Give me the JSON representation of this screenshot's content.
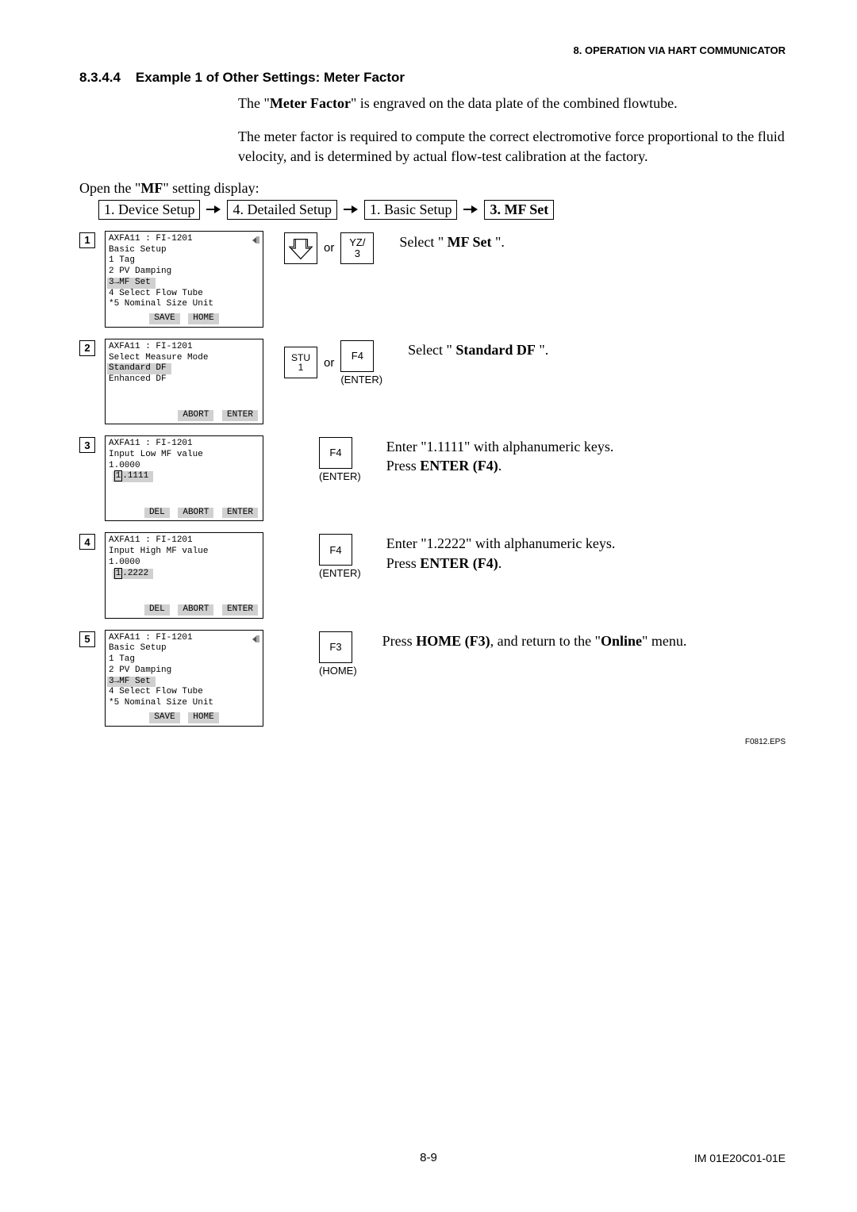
{
  "header": {
    "chapter": "8.  OPERATION VIA HART COMMUNICATOR"
  },
  "section": {
    "number": "8.3.4.4",
    "title": "Example 1 of Other Settings: Meter Factor"
  },
  "paras": {
    "p1a": "The \"",
    "p1b": "Meter Factor",
    "p1c": "\" is engraved on the data plate of the combined flowtube.",
    "p2": "The meter factor is required to compute the correct electromotive force proportional to the fluid velocity, and is determined by actual flow-test calibration at the factory."
  },
  "open": {
    "a": "Open the \"",
    "b": "MF",
    "c": "\" setting display:"
  },
  "breadcrumb": {
    "b1": "1. Device Setup",
    "b2": "4. Detailed Setup",
    "b3": "1. Basic Setup",
    "b4": "3. MF Set"
  },
  "keys": {
    "or": "or",
    "yz": {
      "l1": "YZ/",
      "l2": "3"
    },
    "stu": {
      "l1": "STU",
      "l2": "1"
    },
    "f4": "F4",
    "f3": "F3",
    "enter": "(ENTER)",
    "home": "(HOME)"
  },
  "softkeys": {
    "save": "SAVE",
    "home": "HOME",
    "abort": "ABORT",
    "enter": "ENTER",
    "del": "DEL"
  },
  "steps": {
    "s1": {
      "num": "1",
      "lines": {
        "l0": "AXFA11 : FI-1201",
        "l1": "Basic Setup",
        "l2": " 1 Tag",
        "l3": " 2 PV Damping",
        "l4": " 3→MF Set",
        "l5": " 4 Select Flow Tube",
        "l6": "*5 Nominal Size Unit"
      },
      "desc": {
        "a": "Select \" ",
        "b": "MF Set",
        "c": " \"."
      }
    },
    "s2": {
      "num": "2",
      "lines": {
        "l0": "AXFA11 : FI-1201",
        "l1": "Select Measure Mode",
        "l2": " Standard DF",
        "l3": " Enhanced DF"
      },
      "desc": {
        "a": "Select \" ",
        "b": "Standard DF",
        "c": " \"."
      }
    },
    "s3": {
      "num": "3",
      "lines": {
        "l0": "AXFA11 : FI-1201",
        "l1": "Input Low MF value",
        "l2": " 1.0000",
        "valA": "1",
        "valB": ".1111"
      },
      "desc": {
        "a": "Enter \"1.1111\" with alphanumeric keys.",
        "b": "Press ",
        "c": "ENTER (F4)",
        "d": "."
      }
    },
    "s4": {
      "num": "4",
      "lines": {
        "l0": "AXFA11 : FI-1201",
        "l1": "Input High MF value",
        "l2": " 1.0000",
        "valA": "1",
        "valB": ".2222"
      },
      "desc": {
        "a": "Enter \"1.2222\" with alphanumeric keys.",
        "b": "Press ",
        "c": "ENTER (F4)",
        "d": "."
      }
    },
    "s5": {
      "num": "5",
      "lines": {
        "l0": "AXFA11 : FI-1201",
        "l1": "Basic Setup",
        "l2": " 1 Tag",
        "l3": " 2 PV Damping",
        "l4": " 3→MF Set",
        "l5": " 4 Select Flow Tube",
        "l6": "*5 Nominal Size Unit"
      },
      "desc": {
        "a": "Press ",
        "b": "HOME (F3)",
        "c": ", and return to the \"",
        "d": "Online",
        "e": "\" menu."
      }
    }
  },
  "figlabel": "F0812.EPS",
  "footer": {
    "page": "8-9",
    "doc": "IM 01E20C01-01E"
  }
}
